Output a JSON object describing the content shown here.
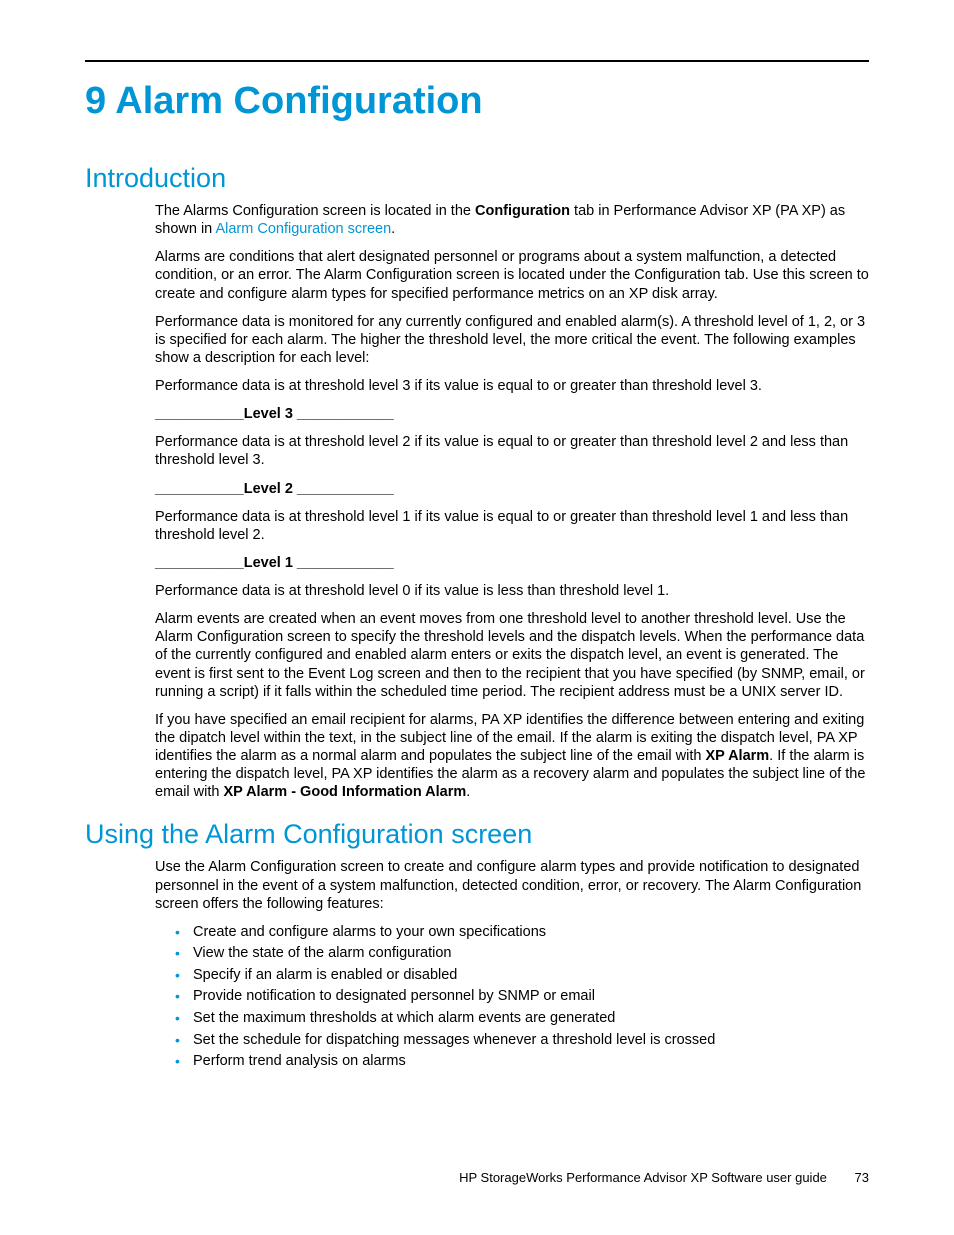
{
  "chapter": {
    "title": "9 Alarm Configuration"
  },
  "intro": {
    "heading": "Introduction",
    "p1a": "The Alarms Configuration screen is located in the ",
    "p1b_bold": "Configuration",
    "p1c": " tab in Performance Advisor XP (PA XP) as shown in ",
    "p1_link": "Alarm Configuration screen",
    "p1d": ".",
    "p2": "Alarms are conditions that alert designated personnel or programs about a system malfunction, a detected condition, or an error.  The Alarm Configuration screen is located under the Configuration tab.  Use this screen to create and configure alarm types for specified performance metrics on an XP disk array.",
    "p3": "Performance data is monitored for any currently configured and enabled alarm(s).  A threshold level of 1, 2, or 3 is specified for each alarm.  The higher the threshold level, the more critical the event.  The following examples show a description for each level:",
    "p4": "Performance data is at threshold level 3 if its value is equal to or greater than threshold level 3.",
    "level3": "___________Level 3 ____________",
    "p5": "Performance data is at threshold level 2 if its value is equal to or greater than threshold level 2 and less than threshold level 3.",
    "level2": "___________Level 2 ____________",
    "p6": "Performance data is at threshold level 1 if its value is equal to or greater than threshold level 1 and less than threshold level 2.",
    "level1": "___________Level 1 ____________",
    "p7": "Performance data is at threshold level 0 if its value is less than threshold level 1.",
    "p8": "Alarm events are created when an event moves from one threshold level to another threshold level. Use the Alarm Configuration screen to specify the threshold levels and the dispatch levels.  When the performance data of the currently configured and enabled alarm enters or exits the dispatch level, an event is generated.  The event is first sent to the Event Log screen and then to the recipient that you have specified (by SNMP, email, or running a script) if it falls within the scheduled time period.  The recipient address must be a UNIX server ID.",
    "p9a": "If you have specified an email recipient for alarms, PA XP identifies the difference between entering and exiting the dipatch level within the text, in the subject line of the email.  If the alarm is exiting the dispatch level, PA XP identifies the alarm as a normal alarm and populates the subject line of the email with ",
    "p9b_bold": "XP Alarm",
    "p9c": ".  If the alarm is entering the dispatch level, PA XP identifies the alarm as a recovery alarm and populates the subject line of the email with ",
    "p9d_bold": "XP Alarm - Good Information Alarm",
    "p9e": "."
  },
  "using": {
    "heading": "Using the Alarm Configuration screen",
    "p1": "Use the Alarm Configuration screen to create and configure alarm types and provide notification to designated personnel in the event of a system malfunction, detected condition, error, or recovery.  The Alarm Configuration screen offers the following features:",
    "features": [
      "Create and configure alarms to your own specifications",
      "View the state of the alarm configuration",
      "Specify if an alarm is enabled or disabled",
      "Provide notification to designated personnel by SNMP or email",
      "Set the maximum thresholds at which alarm events are generated",
      "Set the schedule for dispatching messages whenever a threshold level is crossed",
      "Perform trend analysis on alarms"
    ]
  },
  "footer": {
    "text": "HP StorageWorks Performance Advisor XP Software user guide",
    "page": "73"
  }
}
